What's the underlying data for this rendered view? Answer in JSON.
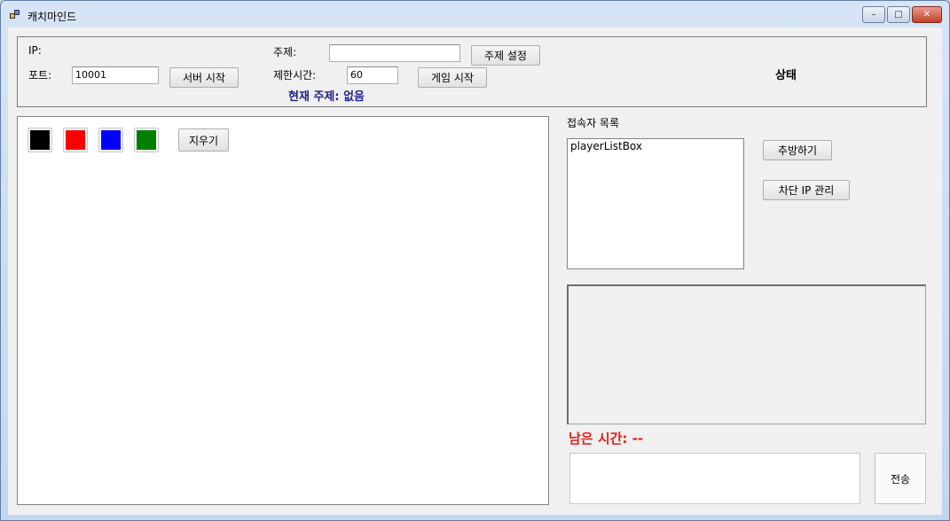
{
  "window": {
    "title": "캐치마인드"
  },
  "server": {
    "ip_label": "IP:",
    "port_label": "포트:",
    "port_value": "10001",
    "start_server_label": "서버 시작"
  },
  "game": {
    "topic_label": "주제:",
    "topic_value": "",
    "set_topic_label": "주제 설정",
    "time_limit_label": "제한시간:",
    "time_limit_value": "60",
    "start_game_label": "게임 시작",
    "current_topic": "현재 주제: 없음",
    "status": "상태"
  },
  "palette": {
    "colors": [
      "#000000",
      "#ff0000",
      "#0000ff",
      "#008000"
    ],
    "clear_label": "지우기"
  },
  "players": {
    "header": "접속자 목록",
    "items": [
      "playerListBox"
    ],
    "kick_label": "추방하기",
    "blocked_ip_label": "차단 IP 관리"
  },
  "chat": {
    "remaining_time": "남은 시간: --",
    "send_label": "전송"
  }
}
